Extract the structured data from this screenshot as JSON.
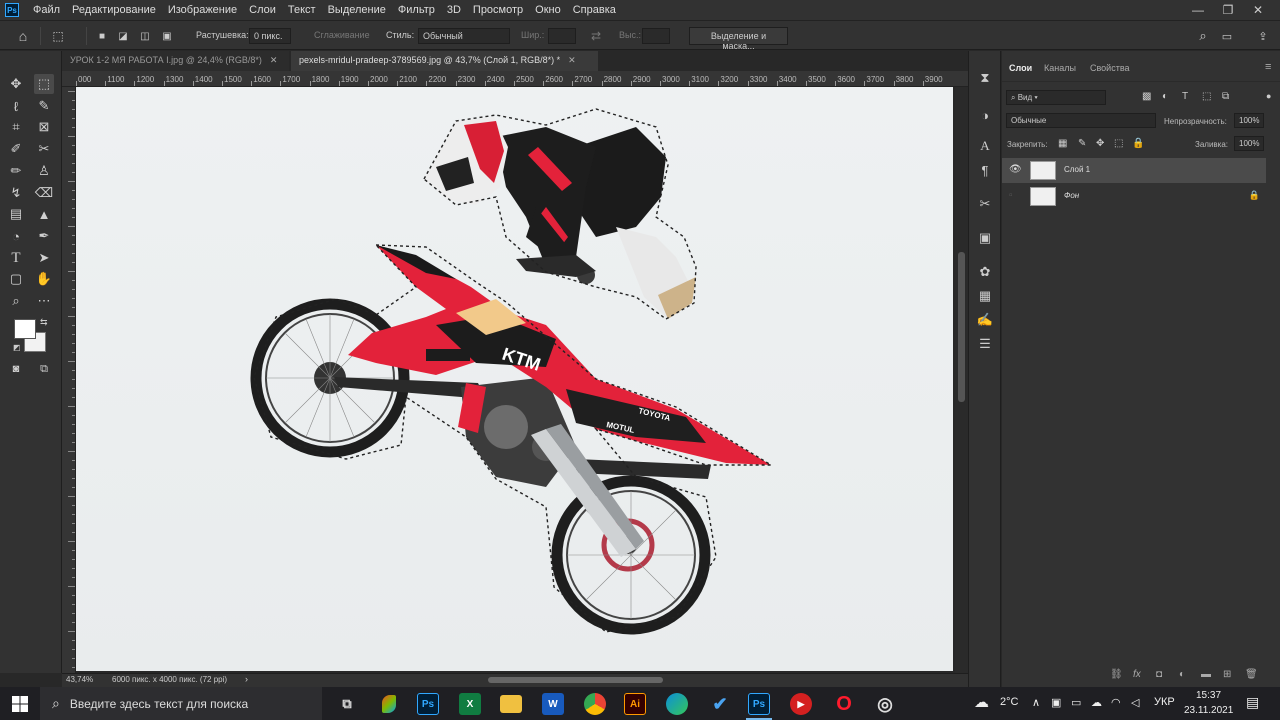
{
  "menubar": {
    "logo": "Ps",
    "items": [
      "Файл",
      "Редактирование",
      "Изображение",
      "Слои",
      "Текст",
      "Выделение",
      "Фильтр",
      "3D",
      "Просмотр",
      "Окно",
      "Справка"
    ],
    "minimize": "—",
    "maximize": "❐",
    "close": "✕"
  },
  "options": {
    "feather_label": "Растушевка:",
    "feather_value": "0 пикс.",
    "antialias_label": "Сглаживание",
    "style_label": "Стиль:",
    "style_value": "Обычный",
    "width_label": "Шир.:",
    "height_label": "Выс.:",
    "mask_button": "Выделение и маска..."
  },
  "tabs": [
    {
      "label": "УРОК 1-2 МЯ РАБОТА I.jpg @ 24,4% (RGB/8*)",
      "close": "✕"
    },
    {
      "label": "pexels-mridul-pradeep-3789569.jpg @ 43,7% (Слой 1, RGB/8*) *",
      "close": "✕"
    }
  ],
  "ruler": {
    "h_ticks": [
      "000",
      "1100",
      "1200",
      "1300",
      "1400",
      "1500",
      "1600",
      "1700",
      "1800",
      "1900",
      "2000",
      "2100",
      "2200",
      "2300",
      "2400",
      "2500",
      "2600",
      "2700",
      "2800",
      "2900",
      "3000",
      "3100",
      "3200",
      "3300",
      "3400",
      "3500",
      "3600",
      "3700",
      "3800",
      "3900"
    ]
  },
  "status": {
    "zoom": "43,74%",
    "doc_info": "6000 пикс. x 4000 пикс. (72 ppi)"
  },
  "panel": {
    "tabs": [
      "Слои",
      "Каналы",
      "Свойства"
    ],
    "filter_value": "Вид",
    "blend_mode": "Обычные",
    "opacity_label": "Непрозрачность:",
    "opacity_value": "100%",
    "lock_label": "Закрепить:",
    "fill_label": "Заливка:",
    "fill_value": "100%",
    "layers": [
      {
        "name": "Слой 1",
        "visible": true,
        "selected": true
      },
      {
        "name": "Фон",
        "visible": false,
        "selected": false,
        "locked": true
      }
    ]
  },
  "taskbar": {
    "search_placeholder": "Введите здесь текст для поиска",
    "apps": [
      "task-view",
      "paint",
      "photoshop",
      "excel",
      "explorer",
      "word",
      "chrome",
      "illustrator",
      "edge",
      "todo",
      "photoshop-active",
      "recorder",
      "opera",
      "obs"
    ],
    "weather": "2°C",
    "lang": "УКР",
    "time": "15:37",
    "date": "23.11.2021"
  },
  "colors": {
    "accent": "#31a8ff",
    "selection": "#e3223a",
    "ui_bg": "#323232",
    "canvas_bg": "#282828"
  }
}
